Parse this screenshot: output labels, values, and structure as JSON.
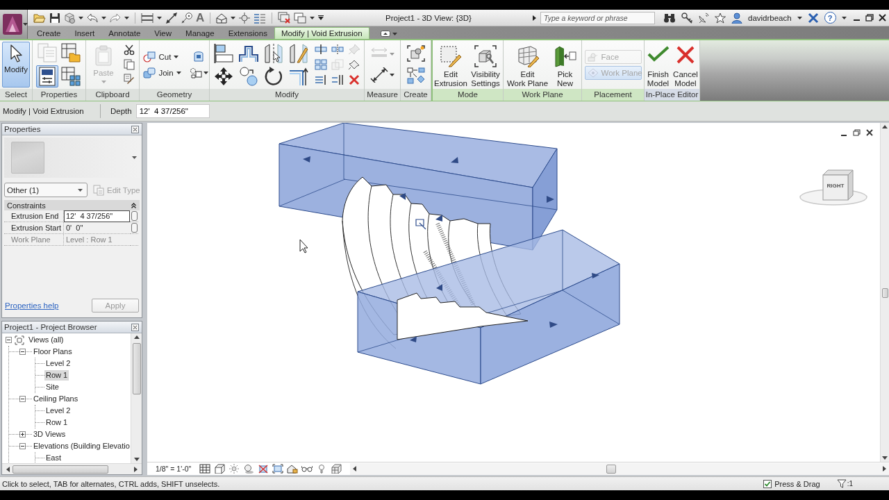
{
  "title_bar": {
    "text_tool": "A",
    "title": "Project1 - 3D View: {3D}",
    "search": {
      "placeholder": "Type a keyword or phrase"
    },
    "user": "davidrbeach",
    "help": "?"
  },
  "tabs": [
    {
      "label": "Create",
      "selected": false
    },
    {
      "label": "Insert",
      "selected": false
    },
    {
      "label": "Annotate",
      "selected": false
    },
    {
      "label": "View",
      "selected": false
    },
    {
      "label": "Manage",
      "selected": false
    },
    {
      "label": "Extensions",
      "selected": false
    },
    {
      "label": "Modify | Void Extrusion",
      "selected": true
    }
  ],
  "ribbon": [
    {
      "label": "Select",
      "kind": "standard",
      "buttons": [
        {
          "label": "Modify",
          "selected": true,
          "disabled": false
        }
      ]
    },
    {
      "label": "Properties",
      "kind": "standard",
      "buttons": [
        {
          "selected": false,
          "disabled": true
        },
        {
          "selected": false,
          "disabled": false
        },
        {
          "selected": true,
          "disabled": false
        },
        {
          "selected": false,
          "disabled": false
        }
      ]
    },
    {
      "label": "Clipboard",
      "kind": "standard",
      "buttons": [
        {
          "label": "Paste",
          "disabled": true
        }
      ]
    },
    {
      "label": "Geometry",
      "kind": "standard",
      "buttons": [
        {
          "label": "Cut"
        },
        {
          "label": "Join"
        }
      ]
    },
    {
      "label": "Modify",
      "kind": "standard",
      "tools": [
        {
          "disabled": false
        },
        {
          "disabled": false
        },
        {
          "disabled": false
        },
        {
          "disabled": false
        },
        {
          "disabled": false
        },
        {
          "disabled": false
        },
        {
          "disabled": false
        },
        {
          "disabled": false
        },
        {
          "disabled": false
        },
        {
          "disabled": false
        },
        {
          "disabled": true
        },
        {
          "disabled": false
        },
        {
          "disabled": true
        },
        {
          "disabled": false
        },
        {
          "disabled": false
        },
        {
          "disabled": false
        },
        {
          "disabled": false
        }
      ]
    },
    {
      "label": "Measure",
      "kind": "standard",
      "tools": [
        {
          "disabled": true
        },
        {
          "disabled": false
        }
      ]
    },
    {
      "label": "Create",
      "kind": "standard"
    },
    {
      "label": "Mode",
      "kind": "contextual",
      "buttons": [
        {
          "label": "Edit\nExtrusion"
        },
        {
          "label": "Visibility\nSettings"
        }
      ]
    },
    {
      "label": "Work Plane",
      "kind": "contextual",
      "buttons": [
        {
          "label": "Edit\nWork Plane"
        },
        {
          "label": "Pick\nNew"
        }
      ]
    },
    {
      "label": "Placement",
      "kind": "contextual",
      "buttons": [
        {
          "label": "Face",
          "selected": false,
          "disabled": true
        },
        {
          "label": "Work Plane",
          "selected": true,
          "disabled": true
        }
      ]
    },
    {
      "label": "In-Place Editor",
      "kind": "editor",
      "buttons": [
        {
          "label": "Finish\nModel"
        },
        {
          "label": "Cancel\nModel"
        }
      ]
    }
  ],
  "options_bar": {
    "context": "Modify | Void Extrusion",
    "depth": {
      "label": "Depth",
      "value": "12'  4 37/256\""
    }
  },
  "properties": {
    "title": "Properties",
    "type_selector": {
      "value": "Other (1)"
    },
    "edit_type": {
      "label": "Edit Type",
      "disabled": true
    },
    "groups": [
      {
        "label": "Constraints",
        "expanded": true,
        "rows": [
          {
            "name": "Extrusion End",
            "value": "12'  4 37/256\"",
            "selected": true,
            "disabled": false
          },
          {
            "name": "Extrusion Start",
            "value": "0'  0\"",
            "selected": false,
            "disabled": false
          },
          {
            "name": "Work Plane",
            "value": "Level : Row 1",
            "selected": false,
            "disabled": true
          }
        ]
      }
    ],
    "help_link": "Properties help",
    "apply": {
      "label": "Apply",
      "disabled": true
    }
  },
  "project_browser": {
    "title": "Project1 - Project Browser",
    "tree": [
      {
        "label": "Views (all)",
        "expanded": true,
        "selected": false,
        "children": [
          {
            "label": "Floor Plans",
            "expanded": true,
            "selected": false,
            "children": [
              {
                "label": "Level 2",
                "selected": false
              },
              {
                "label": "Row 1",
                "selected": true
              },
              {
                "label": "Site",
                "selected": false
              }
            ]
          },
          {
            "label": "Ceiling Plans",
            "expanded": true,
            "selected": false,
            "children": [
              {
                "label": "Level 2",
                "selected": false
              },
              {
                "label": "Row 1",
                "selected": false
              }
            ]
          },
          {
            "label": "3D Views",
            "expanded": false,
            "selected": false
          },
          {
            "label": "Elevations (Building Elevatio",
            "expanded": true,
            "selected": false,
            "children": [
              {
                "label": "East",
                "selected": false
              }
            ]
          }
        ]
      }
    ]
  },
  "view": {
    "view_cube": {
      "label": "RIGHT"
    },
    "scale": "1/8\" = 1'-0\""
  },
  "status_bar": {
    "message": "Click to select, TAB for alternates, CTRL adds, SHIFT unselects.",
    "press_drag": {
      "label": "Press & Drag",
      "checked": true
    },
    "filter_count": ":1"
  }
}
